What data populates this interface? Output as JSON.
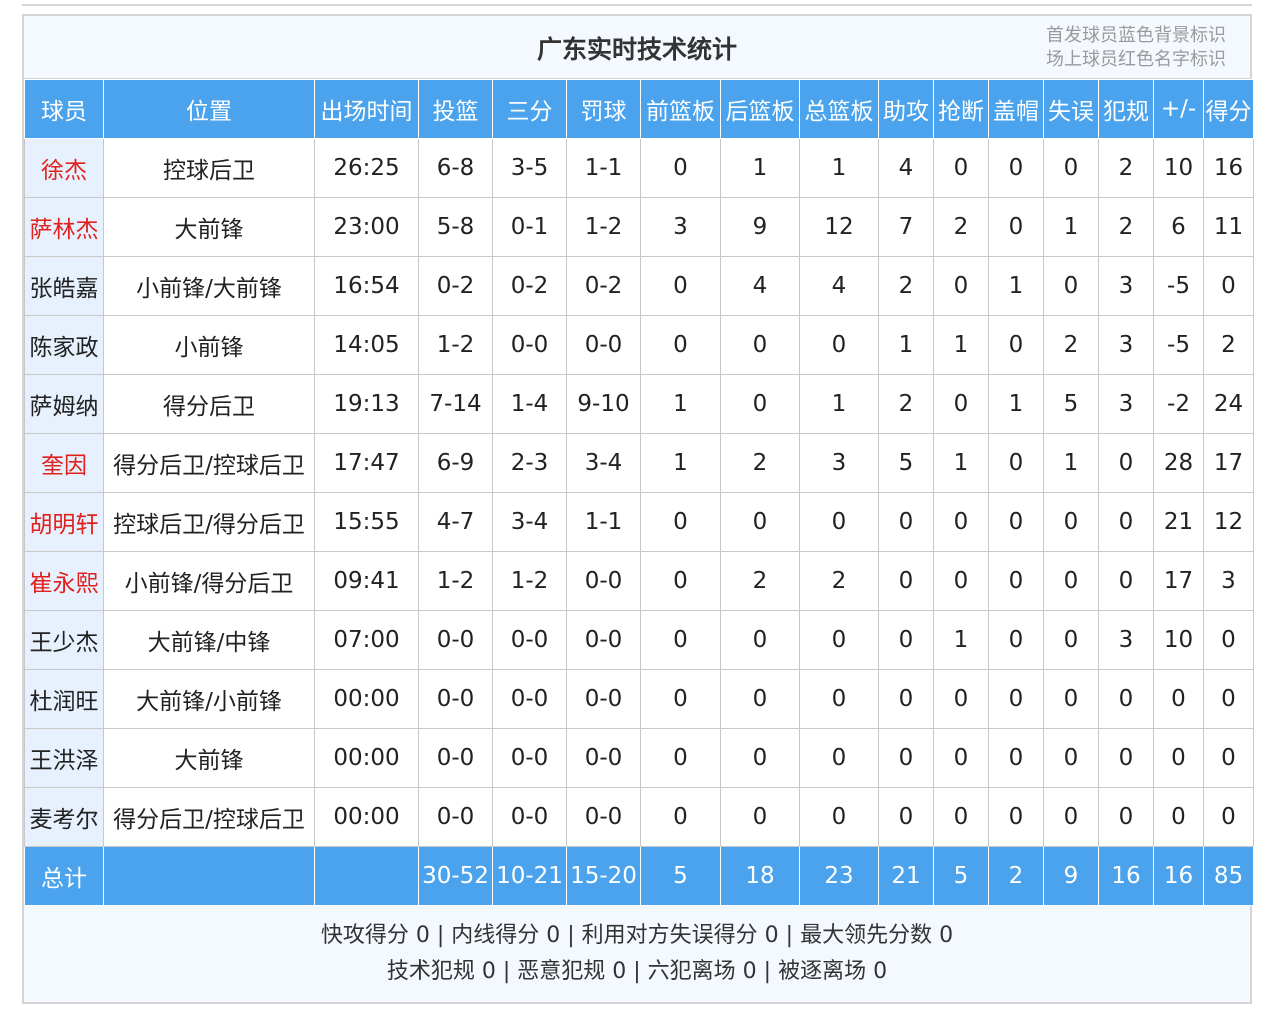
{
  "header": {
    "title": "广东实时技术统计",
    "legend_line1": "首发球员蓝色背景标识",
    "legend_line2": "场上球员红色名字标识"
  },
  "columns": [
    "球员",
    "位置",
    "出场时间",
    "投篮",
    "三分",
    "罚球",
    "前篮板",
    "后篮板",
    "总篮板",
    "助攻",
    "抢断",
    "盖帽",
    "失误",
    "犯规",
    "+/-",
    "得分"
  ],
  "players": [
    {
      "name": "徐杰",
      "red": true,
      "cells": [
        "控球后卫",
        "26:25",
        "6-8",
        "3-5",
        "1-1",
        "0",
        "1",
        "1",
        "4",
        "0",
        "0",
        "0",
        "2",
        "10",
        "16"
      ]
    },
    {
      "name": "萨林杰",
      "red": true,
      "cells": [
        "大前锋",
        "23:00",
        "5-8",
        "0-1",
        "1-2",
        "3",
        "9",
        "12",
        "7",
        "2",
        "0",
        "1",
        "2",
        "6",
        "11"
      ]
    },
    {
      "name": "张皓嘉",
      "red": false,
      "cells": [
        "小前锋/大前锋",
        "16:54",
        "0-2",
        "0-2",
        "0-2",
        "0",
        "4",
        "4",
        "2",
        "0",
        "1",
        "0",
        "3",
        "-5",
        "0"
      ]
    },
    {
      "name": "陈家政",
      "red": false,
      "cells": [
        "小前锋",
        "14:05",
        "1-2",
        "0-0",
        "0-0",
        "0",
        "0",
        "0",
        "1",
        "1",
        "0",
        "2",
        "3",
        "-5",
        "2"
      ]
    },
    {
      "name": "萨姆纳",
      "red": false,
      "cells": [
        "得分后卫",
        "19:13",
        "7-14",
        "1-4",
        "9-10",
        "1",
        "0",
        "1",
        "2",
        "0",
        "1",
        "5",
        "3",
        "-2",
        "24"
      ]
    },
    {
      "name": "奎因",
      "red": true,
      "cells": [
        "得分后卫/控球后卫",
        "17:47",
        "6-9",
        "2-3",
        "3-4",
        "1",
        "2",
        "3",
        "5",
        "1",
        "0",
        "1",
        "0",
        "28",
        "17"
      ]
    },
    {
      "name": "胡明轩",
      "red": true,
      "cells": [
        "控球后卫/得分后卫",
        "15:55",
        "4-7",
        "3-4",
        "1-1",
        "0",
        "0",
        "0",
        "0",
        "0",
        "0",
        "0",
        "0",
        "21",
        "12"
      ]
    },
    {
      "name": "崔永熙",
      "red": true,
      "cells": [
        "小前锋/得分后卫",
        "09:41",
        "1-2",
        "1-2",
        "0-0",
        "0",
        "2",
        "2",
        "0",
        "0",
        "0",
        "0",
        "0",
        "17",
        "3"
      ]
    },
    {
      "name": "王少杰",
      "red": false,
      "cells": [
        "大前锋/中锋",
        "07:00",
        "0-0",
        "0-0",
        "0-0",
        "0",
        "0",
        "0",
        "0",
        "1",
        "0",
        "0",
        "3",
        "10",
        "0"
      ]
    },
    {
      "name": "杜润旺",
      "red": false,
      "cells": [
        "大前锋/小前锋",
        "00:00",
        "0-0",
        "0-0",
        "0-0",
        "0",
        "0",
        "0",
        "0",
        "0",
        "0",
        "0",
        "0",
        "0",
        "0"
      ]
    },
    {
      "name": "王洪泽",
      "red": false,
      "cells": [
        "大前锋",
        "00:00",
        "0-0",
        "0-0",
        "0-0",
        "0",
        "0",
        "0",
        "0",
        "0",
        "0",
        "0",
        "0",
        "0",
        "0"
      ]
    },
    {
      "name": "麦考尔",
      "red": false,
      "cells": [
        "得分后卫/控球后卫",
        "00:00",
        "0-0",
        "0-0",
        "0-0",
        "0",
        "0",
        "0",
        "0",
        "0",
        "0",
        "0",
        "0",
        "0",
        "0"
      ]
    }
  ],
  "totals": {
    "label": "总计",
    "cells": [
      "",
      "",
      "30-52",
      "10-21",
      "15-20",
      "5",
      "18",
      "23",
      "21",
      "5",
      "2",
      "9",
      "16",
      "16",
      "85"
    ]
  },
  "notes": {
    "line1": "快攻得分 0 | 内线得分 0 | 利用对方失误得分 0 | 最大领先分数 0",
    "line2": "技术犯规 0 | 恶意犯规 0 | 六犯离场 0 | 被逐离场 0"
  }
}
